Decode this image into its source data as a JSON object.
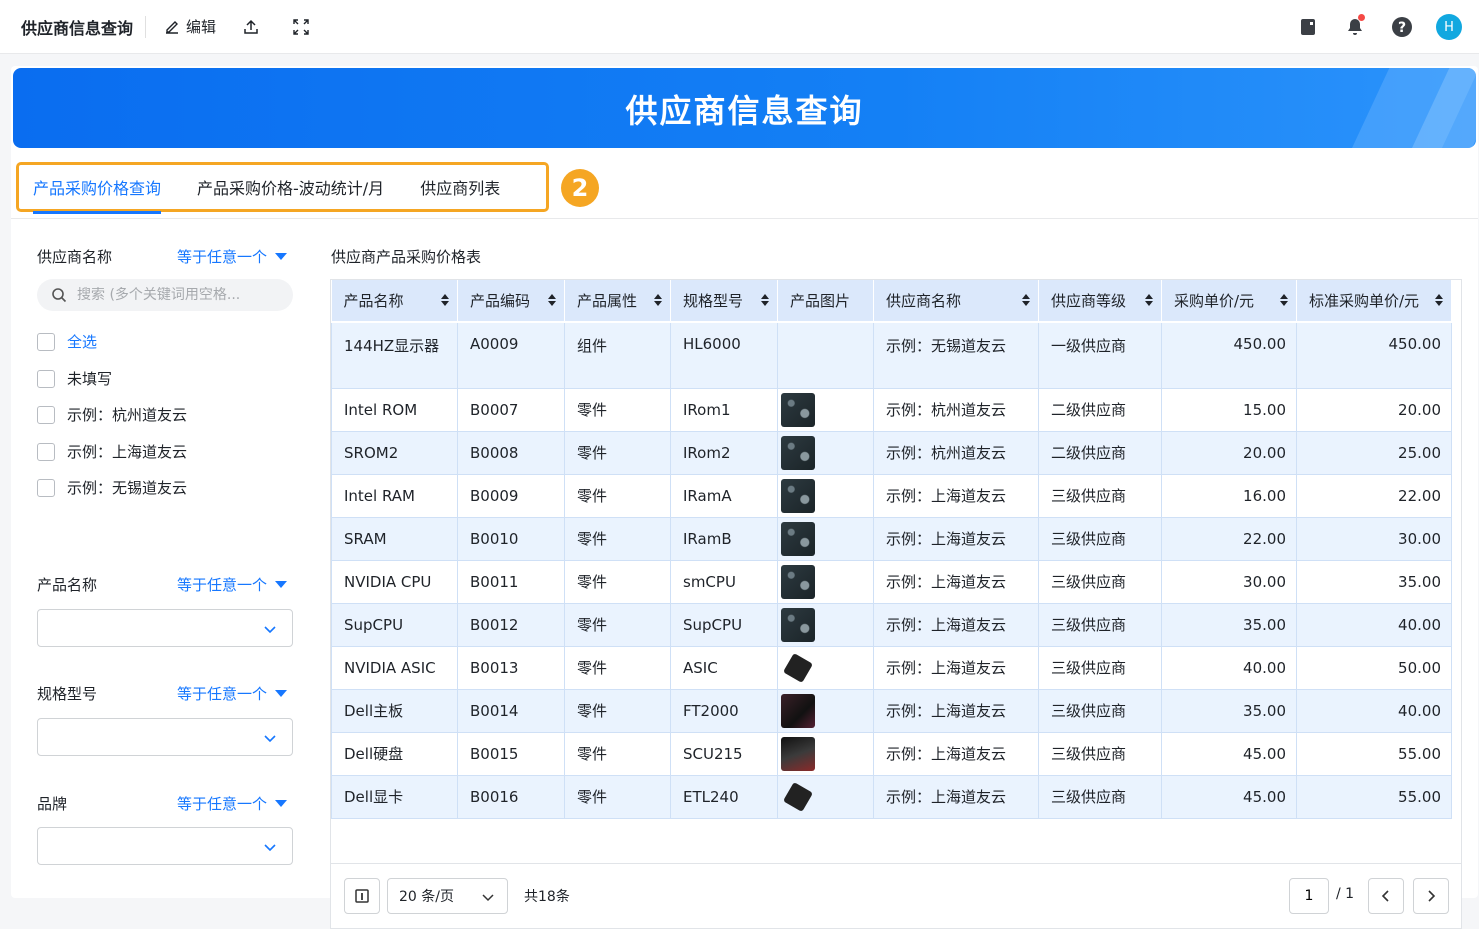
{
  "topbar": {
    "title": "供应商信息查询",
    "edit_label": "编辑",
    "avatar_letter": "H"
  },
  "banner": {
    "title": "供应商信息查询"
  },
  "tabs": [
    {
      "label": "产品采购价格查询",
      "active": true
    },
    {
      "label": "产品采购价格-波动统计/月",
      "active": false
    },
    {
      "label": "供应商列表",
      "active": false
    }
  ],
  "step_badge": "2",
  "filters": {
    "supplier": {
      "label": "供应商名称",
      "mode": "等于任意一个",
      "search_placeholder": "搜索 (多个关键词用空格...",
      "options": [
        "全选",
        "未填写",
        "示例：杭州道友云",
        "示例：上海道友云",
        "示例：无锡道友云"
      ]
    },
    "product": {
      "label": "产品名称",
      "mode": "等于任意一个"
    },
    "spec": {
      "label": "规格型号",
      "mode": "等于任意一个"
    },
    "brand": {
      "label": "品牌",
      "mode": "等于任意一个"
    }
  },
  "table": {
    "title": "供应商产品采购价格表",
    "columns": [
      "产品名称",
      "产品编码",
      "产品属性",
      "规格型号",
      "产品图片",
      "供应商名称",
      "供应商等级",
      "采购单价/元",
      "标准采购单价/元"
    ],
    "rows": [
      {
        "name": "144HZ显示器",
        "code": "A0009",
        "attr": "组件",
        "spec": "HL6000",
        "img": "",
        "supplier": "示例：无锡道友云",
        "level": "一级供应商",
        "price": "450.00",
        "std_price": "450.00"
      },
      {
        "name": "Intel ROM",
        "code": "B0007",
        "attr": "零件",
        "spec": "IRom1",
        "img": "board",
        "supplier": "示例：杭州道友云",
        "level": "二级供应商",
        "price": "15.00",
        "std_price": "20.00"
      },
      {
        "name": "SROM2",
        "code": "B0008",
        "attr": "零件",
        "spec": "IRom2",
        "img": "board",
        "supplier": "示例：杭州道友云",
        "level": "二级供应商",
        "price": "20.00",
        "std_price": "25.00"
      },
      {
        "name": "Intel RAM",
        "code": "B0009",
        "attr": "零件",
        "spec": "IRamA",
        "img": "board",
        "supplier": "示例：上海道友云",
        "level": "三级供应商",
        "price": "16.00",
        "std_price": "22.00"
      },
      {
        "name": "SRAM",
        "code": "B0010",
        "attr": "零件",
        "spec": "IRamB",
        "img": "board",
        "supplier": "示例：上海道友云",
        "level": "三级供应商",
        "price": "22.00",
        "std_price": "30.00"
      },
      {
        "name": "NVIDIA CPU",
        "code": "B0011",
        "attr": "零件",
        "spec": "smCPU",
        "img": "board",
        "supplier": "示例：上海道友云",
        "level": "三级供应商",
        "price": "30.00",
        "std_price": "35.00"
      },
      {
        "name": "SupCPU",
        "code": "B0012",
        "attr": "零件",
        "spec": "SupCPU",
        "img": "board",
        "supplier": "示例：上海道友云",
        "level": "三级供应商",
        "price": "35.00",
        "std_price": "40.00"
      },
      {
        "name": "NVIDIA ASIC",
        "code": "B0013",
        "attr": "零件",
        "spec": "ASIC",
        "img": "asic",
        "supplier": "示例：上海道友云",
        "level": "三级供应商",
        "price": "40.00",
        "std_price": "50.00"
      },
      {
        "name": "Dell主板",
        "code": "B0014",
        "attr": "零件",
        "spec": "FT2000",
        "img": "mb",
        "supplier": "示例：上海道友云",
        "level": "三级供应商",
        "price": "35.00",
        "std_price": "40.00"
      },
      {
        "name": "Dell硬盘",
        "code": "B0015",
        "attr": "零件",
        "spec": "SCU215",
        "img": "hd",
        "supplier": "示例：上海道友云",
        "level": "三级供应商",
        "price": "45.00",
        "std_price": "55.00"
      },
      {
        "name": "Dell显卡",
        "code": "B0016",
        "attr": "零件",
        "spec": "ETL240",
        "img": "asic",
        "supplier": "示例：上海道友云",
        "level": "三级供应商",
        "price": "45.00",
        "std_price": "55.00"
      }
    ]
  },
  "pager": {
    "page_size": "20 条/页",
    "total": "共18条",
    "current_page": "1",
    "of_pages": "/ 1"
  },
  "colors": {
    "primary": "#1677ff",
    "highlight": "#f5a623",
    "header_bg": "#dbe8fb"
  }
}
